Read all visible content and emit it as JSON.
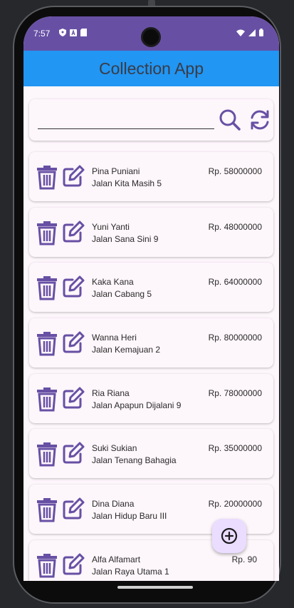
{
  "status_bar": {
    "time": "7:57",
    "icons_left": [
      "shield-icon",
      "a-icon",
      "sd-card-icon"
    ],
    "icons_right": [
      "wifi-icon",
      "signal-icon",
      "battery-icon"
    ]
  },
  "app_bar": {
    "title": "Collection App"
  },
  "search": {
    "value": "",
    "placeholder": ""
  },
  "items": [
    {
      "name": "Pina Puniani",
      "address": "Jalan Kita Masih 5",
      "price": "Rp. 58000000"
    },
    {
      "name": "Yuni Yanti",
      "address": "Jalan Sana Sini 9",
      "price": "Rp. 48000000"
    },
    {
      "name": "Kaka Kana",
      "address": "Jalan Cabang 5",
      "price": "Rp. 64000000"
    },
    {
      "name": "Wanna Heri",
      "address": "Jalan Kemajuan 2",
      "price": "Rp. 80000000"
    },
    {
      "name": "Ria Riana",
      "address": "Jalan Apapun Dijalani 9",
      "price": "Rp. 78000000"
    },
    {
      "name": "Suki Sukian",
      "address": "Jalan Tenang Bahagia",
      "price": "Rp. 35000000"
    },
    {
      "name": "Dina Diana",
      "address": "Jalan Hidup Baru III",
      "price": "Rp. 20000000"
    },
    {
      "name": "Alfa Alfamart",
      "address": "Jalan Raya Utama 1",
      "price": "Rp. 90"
    }
  ],
  "colors": {
    "primary": "#6750a4",
    "app_bar": "#2196f3",
    "background": "#fdf6fb",
    "fab": "#eaddff",
    "text": "#2a2a2a"
  }
}
